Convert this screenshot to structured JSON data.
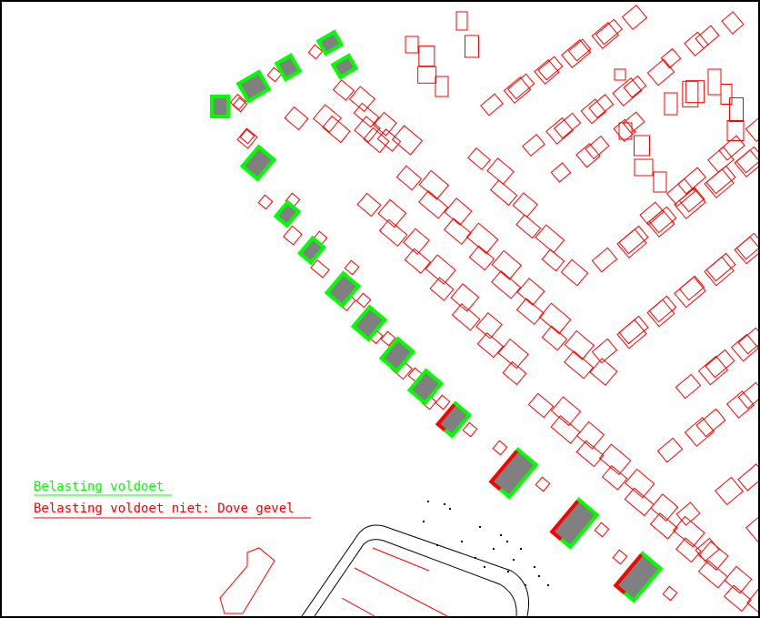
{
  "legend": {
    "items": [
      {
        "label": "Belasting voldoet",
        "color": "#00ff00"
      },
      {
        "label": "Belasting voldoet niet: Dove gevel",
        "color": "#ff0000"
      }
    ]
  },
  "colors": {
    "building_outline": "#ff0000",
    "pass": "#00ff00",
    "fail": "#ff0000",
    "fill": "#808080",
    "road": "#000000"
  }
}
